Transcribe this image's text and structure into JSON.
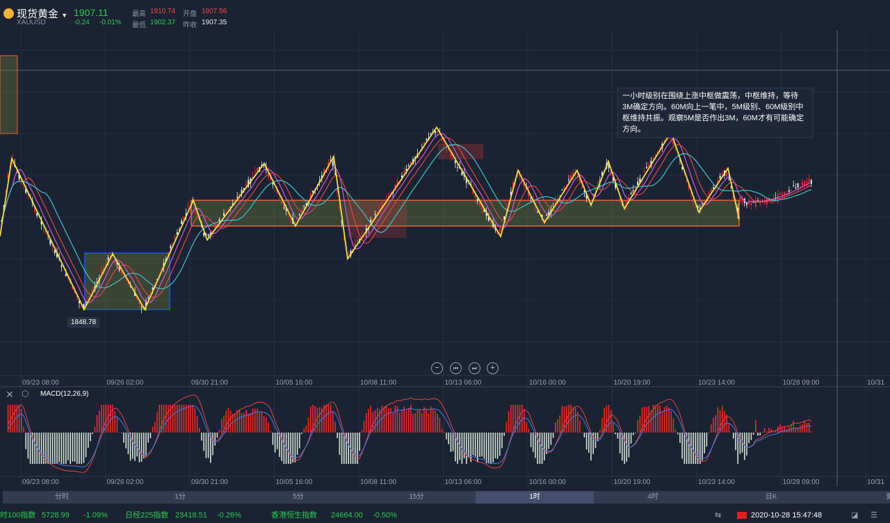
{
  "header": {
    "name": "现货黄金",
    "symbol": "XAUUSD",
    "price": "1907.11",
    "change": "-0.24",
    "change_pct": "-0.01%",
    "high_label": "最高",
    "high": "1910.74",
    "open_label": "开盘",
    "open": "1907.56",
    "low_label": "最低",
    "low": "1902.37",
    "prev_label": "昨收",
    "prev": "1907.35"
  },
  "annotation": "一小时级别在围绕上涨中枢做震荡，中枢维持，等待3M确定方向。60M向上一笔中，5M级别、60M级别中枢维持共振。观察5M是否作出3M，60M才有可能确定方向。",
  "low_marker": "1848.78",
  "time_axis": [
    "09/23 08:00",
    "09/26 02:00",
    "09/30 21:00",
    "10/05 16:00",
    "10/08 11:00",
    "10/13 06:00",
    "10/16 00:00",
    "10/20 19:00",
    "10/23 14:00",
    "10/28 09:00",
    "10/31"
  ],
  "controls": [
    "−",
    "⏮",
    "⏭",
    "+"
  ],
  "macd": {
    "label": "MACD(12,26,9)"
  },
  "tabs": [
    {
      "label": "分时"
    },
    {
      "label": "1分"
    },
    {
      "label": "5分"
    },
    {
      "label": "15分"
    },
    {
      "label": "1时",
      "active": true
    },
    {
      "label": "4时"
    },
    {
      "label": "日K"
    },
    {
      "label": "更"
    }
  ],
  "ticker": [
    {
      "name": "时100指数",
      "value": "5728.99",
      "pct": "-1.09%"
    },
    {
      "name": "日经225指数",
      "value": "23418.51",
      "pct": "-0.26%"
    },
    {
      "name": "香港恒生指数",
      "value": "24664.00",
      "pct": "-0.50%"
    }
  ],
  "datetime": "2020-10-28 15:47:48",
  "colors": {
    "up": "#ef2b2b",
    "down": "#2ecc55",
    "zigzag": "#f4e04d",
    "box_border": "#e8643c",
    "pivot_box": "#1f4bd8"
  }
}
